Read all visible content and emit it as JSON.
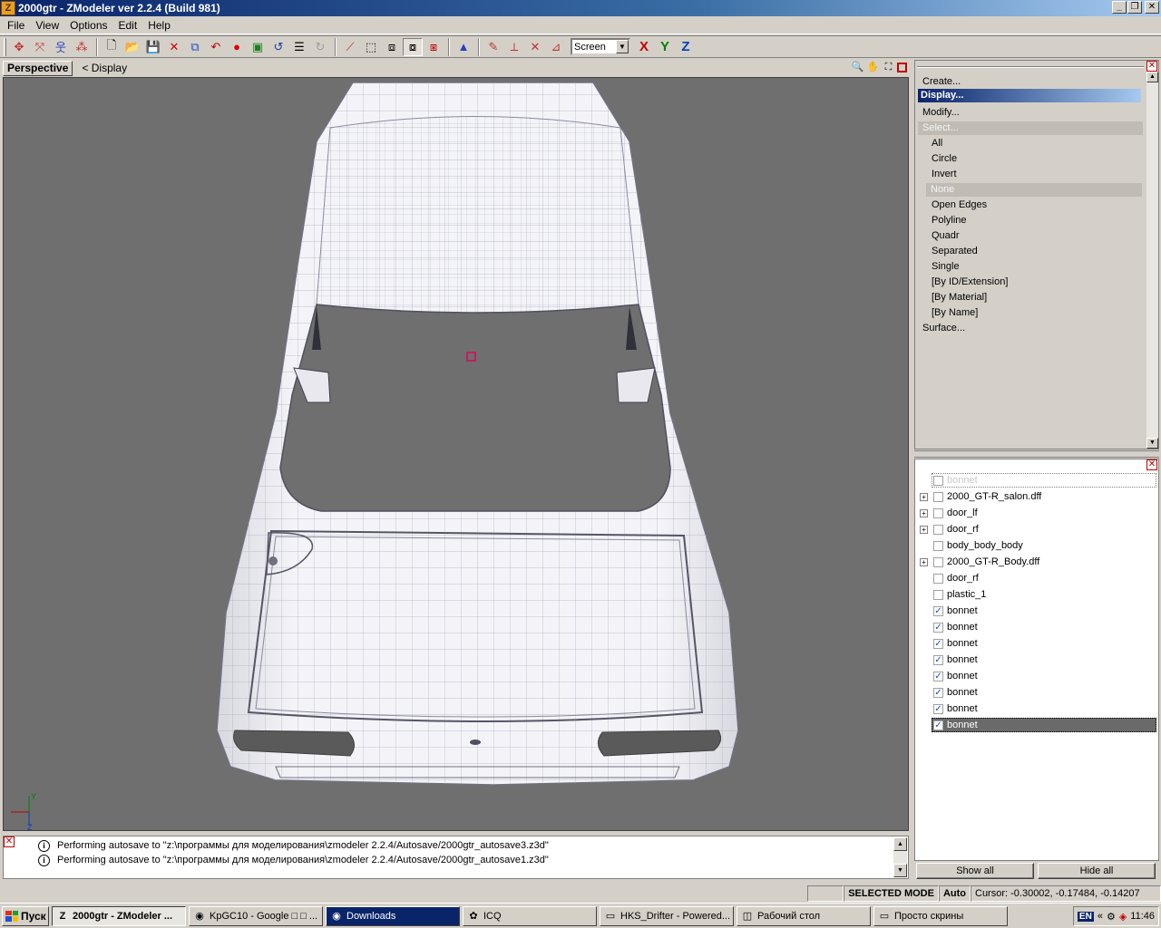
{
  "window": {
    "title": "2000gtr - ZModeler ver 2.2.4 (Build 981)",
    "icon_letter": "Z",
    "min_glyph": "_",
    "max_glyph": "❐",
    "close_glyph": "✕"
  },
  "menu": {
    "items": [
      {
        "label": "File"
      },
      {
        "label": "View"
      },
      {
        "label": "Options"
      },
      {
        "label": "Edit"
      },
      {
        "label": "Help"
      }
    ]
  },
  "toolbar": {
    "coord_select": "Screen",
    "axis_x": "X",
    "axis_y": "Y",
    "axis_z": "Z",
    "icons": [
      "pointer-icon",
      "move-icon",
      "walk-icon",
      "group-icon",
      "new-file-icon",
      "open-file-icon",
      "save-icon",
      "delete-icon",
      "export-icon",
      "undo-red-icon",
      "record-icon",
      "render-icon",
      "undo-icon",
      "notes-icon",
      "redo-icon",
      "vertex-mode-icon",
      "box-icon",
      "cube-icon",
      "cube-selected-icon",
      "cube-red-icon",
      "cone-icon",
      "paint-icon",
      "axis-icon",
      "axis-cross-icon",
      "axis-frame-icon"
    ]
  },
  "viewport": {
    "tab": "Perspective",
    "crumb": "< Display",
    "axis_y": "Y",
    "axis_z": "Z",
    "colors": {
      "background": "#6f6f6f",
      "mesh": "#f2f2f7",
      "wire": "#9a9ab0"
    }
  },
  "command_panel": {
    "items": [
      {
        "label": "Create...",
        "state": "normal",
        "level": 0
      },
      {
        "label": "Display...",
        "state": "active",
        "level": 0
      },
      {
        "label": "Modify...",
        "state": "normal",
        "level": 0
      },
      {
        "label": "Select...",
        "state": "disabled",
        "level": 0
      },
      {
        "label": "All",
        "state": "normal",
        "level": 1
      },
      {
        "label": "Circle",
        "state": "normal",
        "level": 1
      },
      {
        "label": "Invert",
        "state": "normal",
        "level": 1
      },
      {
        "label": "None",
        "state": "disabled",
        "level": 1
      },
      {
        "label": "Open Edges",
        "state": "normal",
        "level": 1
      },
      {
        "label": "Polyline",
        "state": "normal",
        "level": 1
      },
      {
        "label": "Quadr",
        "state": "normal",
        "level": 1
      },
      {
        "label": "Separated",
        "state": "normal",
        "level": 1
      },
      {
        "label": "Single",
        "state": "normal",
        "level": 1
      },
      {
        "label": "[By ID/Extension]",
        "state": "normal",
        "level": 1
      },
      {
        "label": "[By Material]",
        "state": "normal",
        "level": 1
      },
      {
        "label": "[By Name]",
        "state": "normal",
        "level": 1
      },
      {
        "label": "Surface...",
        "state": "normal",
        "level": 0
      }
    ]
  },
  "object_tree": {
    "items": [
      {
        "label": "bonnet",
        "expandable": false,
        "checked": false,
        "faded": true
      },
      {
        "label": "2000_GT-R_salon.dff",
        "expandable": true,
        "checked": false
      },
      {
        "label": "door_lf",
        "expandable": true,
        "checked": false
      },
      {
        "label": "door_rf",
        "expandable": true,
        "checked": false
      },
      {
        "label": "body_body_body",
        "expandable": false,
        "checked": false
      },
      {
        "label": "2000_GT-R_Body.dff",
        "expandable": true,
        "checked": false
      },
      {
        "label": "door_rf",
        "expandable": false,
        "checked": false
      },
      {
        "label": "plastic_1",
        "expandable": false,
        "checked": false
      },
      {
        "label": "bonnet",
        "expandable": false,
        "checked": true
      },
      {
        "label": "bonnet",
        "expandable": false,
        "checked": true
      },
      {
        "label": "bonnet",
        "expandable": false,
        "checked": true
      },
      {
        "label": "bonnet",
        "expandable": false,
        "checked": true
      },
      {
        "label": "bonnet",
        "expandable": false,
        "checked": true
      },
      {
        "label": "bonnet",
        "expandable": false,
        "checked": true
      },
      {
        "label": "bonnet",
        "expandable": false,
        "checked": true
      },
      {
        "label": "bonnet",
        "expandable": false,
        "checked": true,
        "selected": true
      }
    ],
    "show_all": "Show all",
    "hide_all": "Hide all"
  },
  "log": {
    "lines": [
      "Performing autosave to \"z:\\программы для моделирования\\zmodeler 2.2.4/Autosave/2000gtr_autosave3.z3d\"",
      "Performing autosave to \"z:\\программы для моделирования\\zmodeler 2.2.4/Autosave/2000gtr_autosave1.z3d\""
    ],
    "info_glyph": "i"
  },
  "status": {
    "mode": "SELECTED MODE",
    "auto": "Auto",
    "cursor": "Cursor: -0.30002, -0.17484, -0.14207"
  },
  "taskbar": {
    "start": "Пуск",
    "tasks": [
      {
        "label": "2000gtr - ZModeler ...",
        "icon": "Z",
        "state": "active"
      },
      {
        "label": "KpGC10 - Google □ □ ...",
        "icon": "◉",
        "state": "normal"
      },
      {
        "label": "Downloads",
        "icon": "◉",
        "state": "downloads"
      },
      {
        "label": "ICQ",
        "icon": "✿",
        "state": "normal"
      },
      {
        "label": "HKS_Drifter - Powered...",
        "icon": "▭",
        "state": "normal"
      },
      {
        "label": "Рабочий стол",
        "icon": "◫",
        "state": "normal"
      },
      {
        "label": "Просто скрины",
        "icon": "▭",
        "state": "normal"
      }
    ],
    "lang": "EN",
    "arrows": "«",
    "clock": "11:46"
  }
}
